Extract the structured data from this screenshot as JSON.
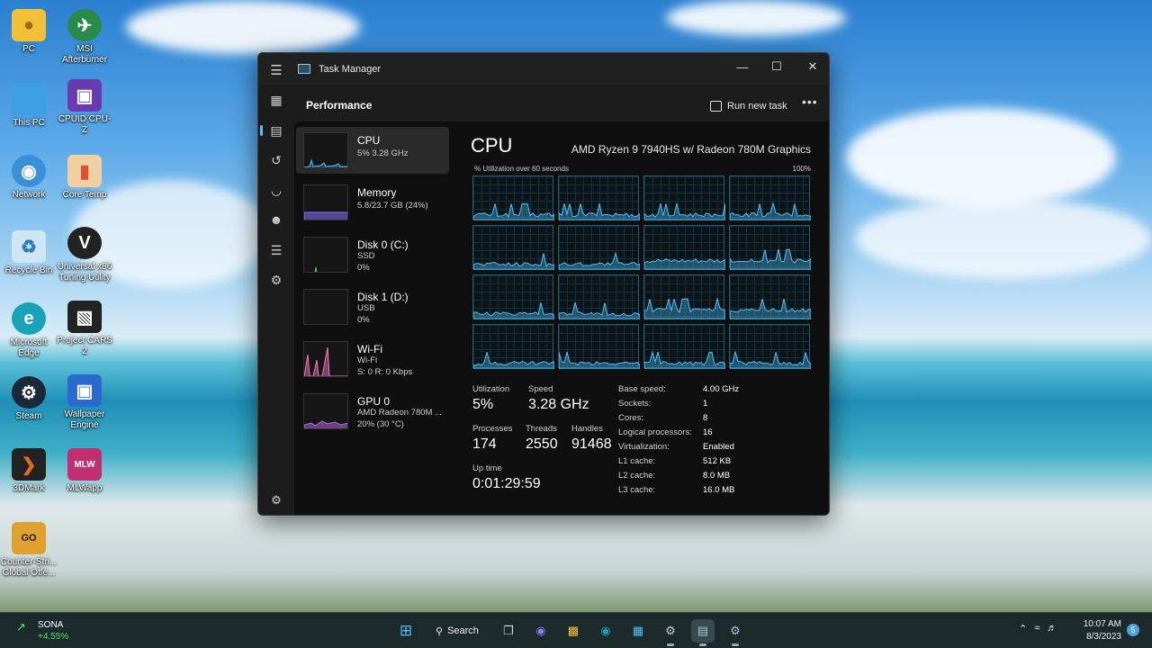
{
  "desktop": {
    "icons": [
      {
        "label": "PC",
        "icon": "folder-user-icon",
        "color": "#f2c037"
      },
      {
        "label": "MSI Afterburner",
        "icon": "afterburner-icon",
        "color": "#2a8a4a"
      },
      {
        "label": "This PC",
        "icon": "monitor-icon",
        "color": "#3aa0e0"
      },
      {
        "label": "CPUID CPU-Z",
        "icon": "cpuz-icon",
        "color": "#6a3ab0"
      },
      {
        "label": "Network",
        "icon": "network-icon",
        "color": "#3a90d8"
      },
      {
        "label": "Core Temp",
        "icon": "thermometer-icon",
        "color": "#e05030"
      },
      {
        "label": "Recycle Bin",
        "icon": "recycle-bin-icon",
        "color": "#cfe6f5"
      },
      {
        "label": "Universal x86 Tuning Utility",
        "icon": "tuning-icon",
        "color": "#222222"
      },
      {
        "label": "Microsoft Edge",
        "icon": "edge-icon",
        "color": "#1aa3b8"
      },
      {
        "label": "Project CARS 2",
        "icon": "project-cars-icon",
        "color": "#222222"
      },
      {
        "label": "Steam",
        "icon": "steam-icon",
        "color": "#1b2838"
      },
      {
        "label": "Wallpaper Engine",
        "icon": "wallpaper-engine-icon",
        "color": "#2a6ad0"
      },
      {
        "label": "3DMark",
        "icon": "3dmark-icon",
        "color": "#e06a20"
      },
      {
        "label": "MLWapp",
        "icon": "mlwapp-icon",
        "color": "#c03070"
      },
      {
        "label": "Counter-Stri... Global Offe...",
        "icon": "csgo-icon",
        "color": "#e0a030"
      }
    ]
  },
  "window": {
    "title": "Task Manager",
    "controls": {
      "minimize": "—",
      "maximize": "☐",
      "close": "✕"
    }
  },
  "header": {
    "title": "Performance",
    "run_new_task": "Run new task",
    "more": "•••"
  },
  "nav": [
    "Processes",
    "Performance",
    "App history",
    "Startup apps",
    "Users",
    "Details",
    "Services"
  ],
  "perf_list": [
    {
      "name": "CPU",
      "line1": "5%  3.28 GHz",
      "line2": "",
      "selected": true,
      "color": "#4cc2ff"
    },
    {
      "name": "Memory",
      "line1": "5.8/23.7 GB (24%)",
      "line2": "",
      "selected": false,
      "color": "#8a6dff"
    },
    {
      "name": "Disk 0 (C:)",
      "line1": "SSD",
      "line2": "0%",
      "selected": false,
      "color": "#5fd36b"
    },
    {
      "name": "Disk 1 (D:)",
      "line1": "USB",
      "line2": "0%",
      "selected": false,
      "color": "#5fd36b"
    },
    {
      "name": "Wi-Fi",
      "line1": "Wi-Fi",
      "line2": "S: 0  R: 0 Kbps",
      "selected": false,
      "color": "#f07ac0"
    },
    {
      "name": "GPU 0",
      "line1": "AMD Radeon 780M ...",
      "line2": "20%  (30 °C)",
      "selected": false,
      "color": "#b06ad8"
    }
  ],
  "detail": {
    "title": "CPU",
    "model": "AMD Ryzen 9 7940HS w/ Radeon 780M Graphics",
    "caption": "% Utilization over 60 seconds",
    "max_label": "100%",
    "stats": {
      "utilization_label": "Utilization",
      "utilization": "5%",
      "speed_label": "Speed",
      "speed": "3.28 GHz",
      "processes_label": "Processes",
      "processes": "174",
      "threads_label": "Threads",
      "threads": "2550",
      "handles_label": "Handles",
      "handles": "91468",
      "uptime_label": "Up time",
      "uptime": "0:01:29:59"
    },
    "specs": [
      {
        "k": "Base speed:",
        "v": "4.00 GHz"
      },
      {
        "k": "Sockets:",
        "v": "1"
      },
      {
        "k": "Cores:",
        "v": "8"
      },
      {
        "k": "Logical processors:",
        "v": "16"
      },
      {
        "k": "Virtualization:",
        "v": "Enabled"
      },
      {
        "k": "L1 cache:",
        "v": "512 KB"
      },
      {
        "k": "L2 cache:",
        "v": "8.0 MB"
      },
      {
        "k": "L3 cache:",
        "v": "16.0 MB"
      }
    ]
  },
  "taskbar": {
    "stock_name": "SONA",
    "stock_change": "+4.55%",
    "search": "Search",
    "clock_time": "10:07 AM",
    "clock_date": "8/3/2023",
    "notifications": "5"
  }
}
